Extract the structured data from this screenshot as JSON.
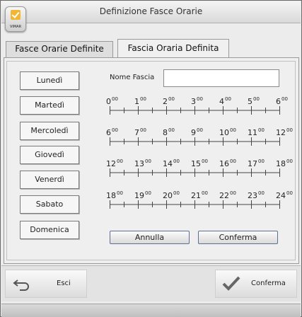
{
  "window": {
    "title": "Definizione Fasce Orarie",
    "logo_text": "VIMAR"
  },
  "tabs": [
    {
      "label": "Fasce Orarie Definite",
      "active": false
    },
    {
      "label": "Fascia Oraria Definita",
      "active": true
    }
  ],
  "days": [
    "Lunedì",
    "Martedì",
    "Mercoledì",
    "Giovedì",
    "Venerdì",
    "Sabato",
    "Domenica"
  ],
  "name_field": {
    "label": "Nome Fascia",
    "value": ""
  },
  "rulers": [
    {
      "labels": [
        "0",
        "1",
        "2",
        "3",
        "4",
        "5",
        "6"
      ]
    },
    {
      "labels": [
        "6",
        "7",
        "8",
        "9",
        "10",
        "11",
        "12"
      ]
    },
    {
      "labels": [
        "12",
        "13",
        "14",
        "15",
        "16",
        "17",
        "18"
      ]
    },
    {
      "labels": [
        "18",
        "19",
        "20",
        "21",
        "22",
        "23",
        "24"
      ]
    }
  ],
  "minutes_superscript": "00",
  "buttons": {
    "cancel": "Annulla",
    "confirm": "Conferma"
  },
  "footer": {
    "exit": "Esci",
    "confirm": "Conferma"
  },
  "colors": {
    "accent": "#f1b633",
    "button_border": "#5b6f93"
  }
}
